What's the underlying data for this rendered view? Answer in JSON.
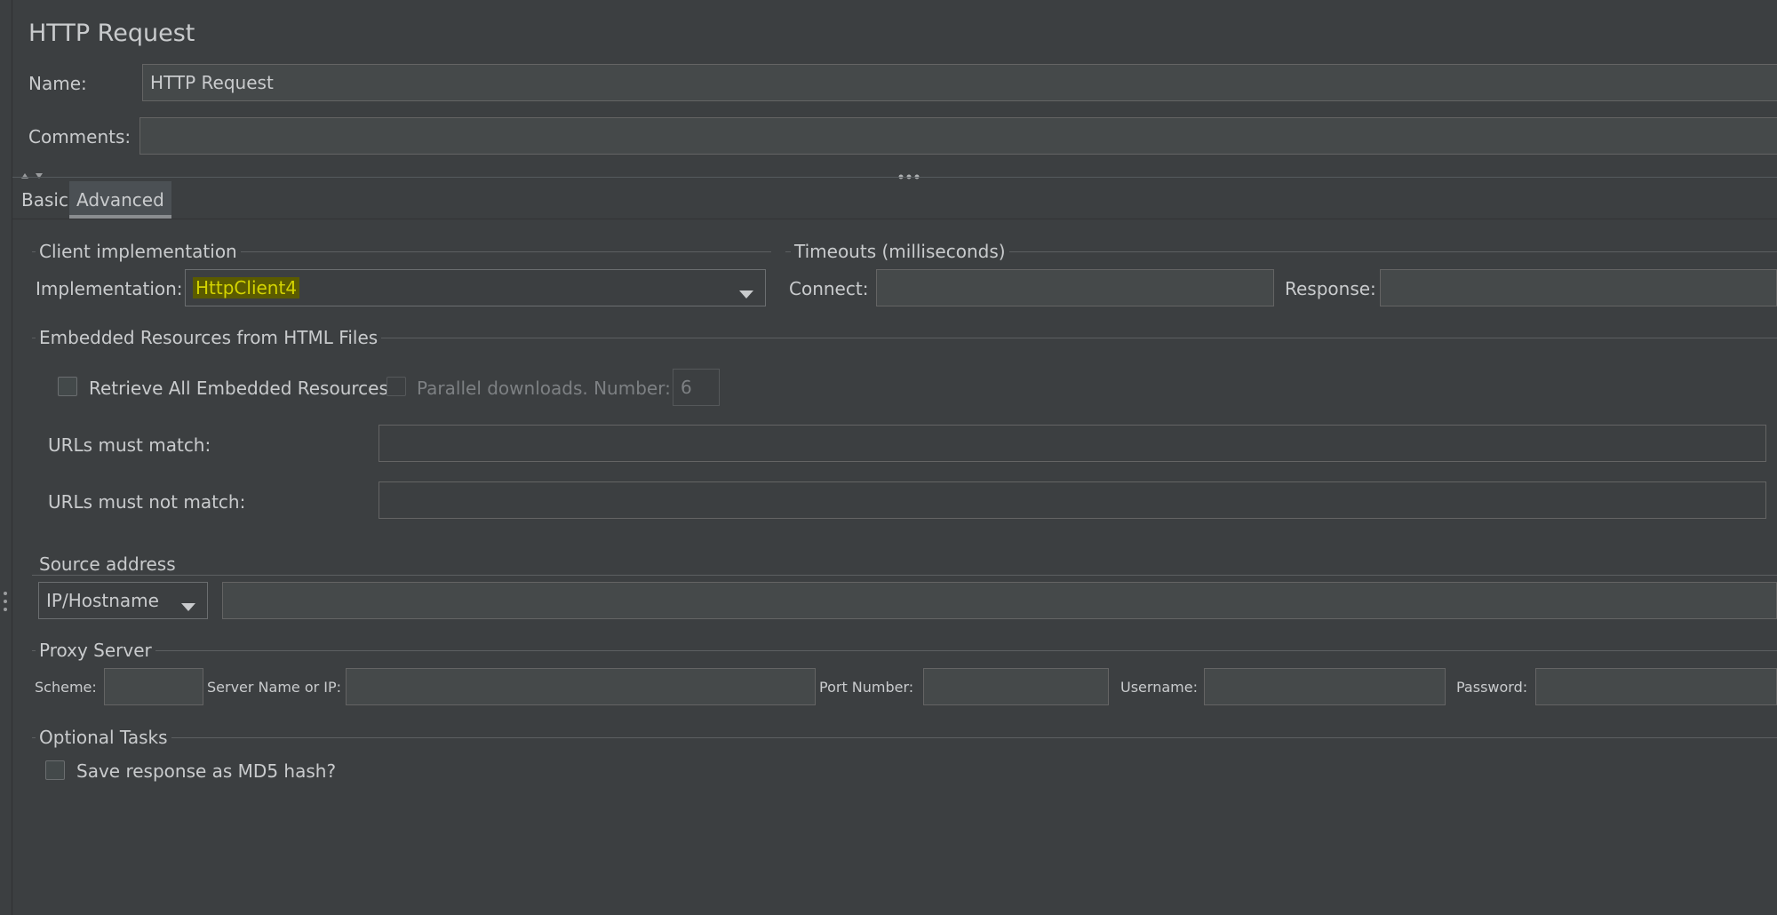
{
  "header": {
    "title": "HTTP Request"
  },
  "name_field": {
    "label": "Name:",
    "value": "HTTP Request"
  },
  "comments_field": {
    "label": "Comments:",
    "value": ""
  },
  "tabs": [
    {
      "label": "Basic",
      "selected": false
    },
    {
      "label": "Advanced",
      "selected": true
    }
  ],
  "client_impl": {
    "title": "Client implementation",
    "label": "Implementation:",
    "value": "HttpClient4",
    "highlight_color": "#5b5b00",
    "value_color": "#d4d400"
  },
  "timeouts": {
    "title": "Timeouts (milliseconds)",
    "connect_label": "Connect:",
    "connect_value": "",
    "response_label": "Response:",
    "response_value": ""
  },
  "embedded": {
    "title": "Embedded Resources from HTML Files",
    "retrieve_label": "Retrieve All Embedded Resources",
    "retrieve_checked": false,
    "parallel_label": "Parallel downloads. Number:",
    "parallel_checked": false,
    "parallel_number": "6",
    "urls_match_label": "URLs must match:",
    "urls_match_value": "",
    "urls_not_match_label": "URLs must not match:",
    "urls_not_match_value": ""
  },
  "source_address": {
    "title": "Source address",
    "type_selected": "IP/Hostname",
    "value": ""
  },
  "proxy": {
    "title": "Proxy Server",
    "scheme_label": "Scheme:",
    "server_label": "Server Name or IP:",
    "port_label": "Port Number:",
    "username_label": "Username:",
    "password_label": "Password:"
  },
  "optional_tasks": {
    "title": "Optional Tasks",
    "md5_label": "Save response as MD5 hash?",
    "md5_checked": false
  },
  "icons": {
    "splitter_arrows": "up-down-arrow-icon",
    "splitter_grip": "drag-handle-icon",
    "dropdown": "chevron-down-icon",
    "side_grip": "vertical-drag-handle-icon"
  }
}
